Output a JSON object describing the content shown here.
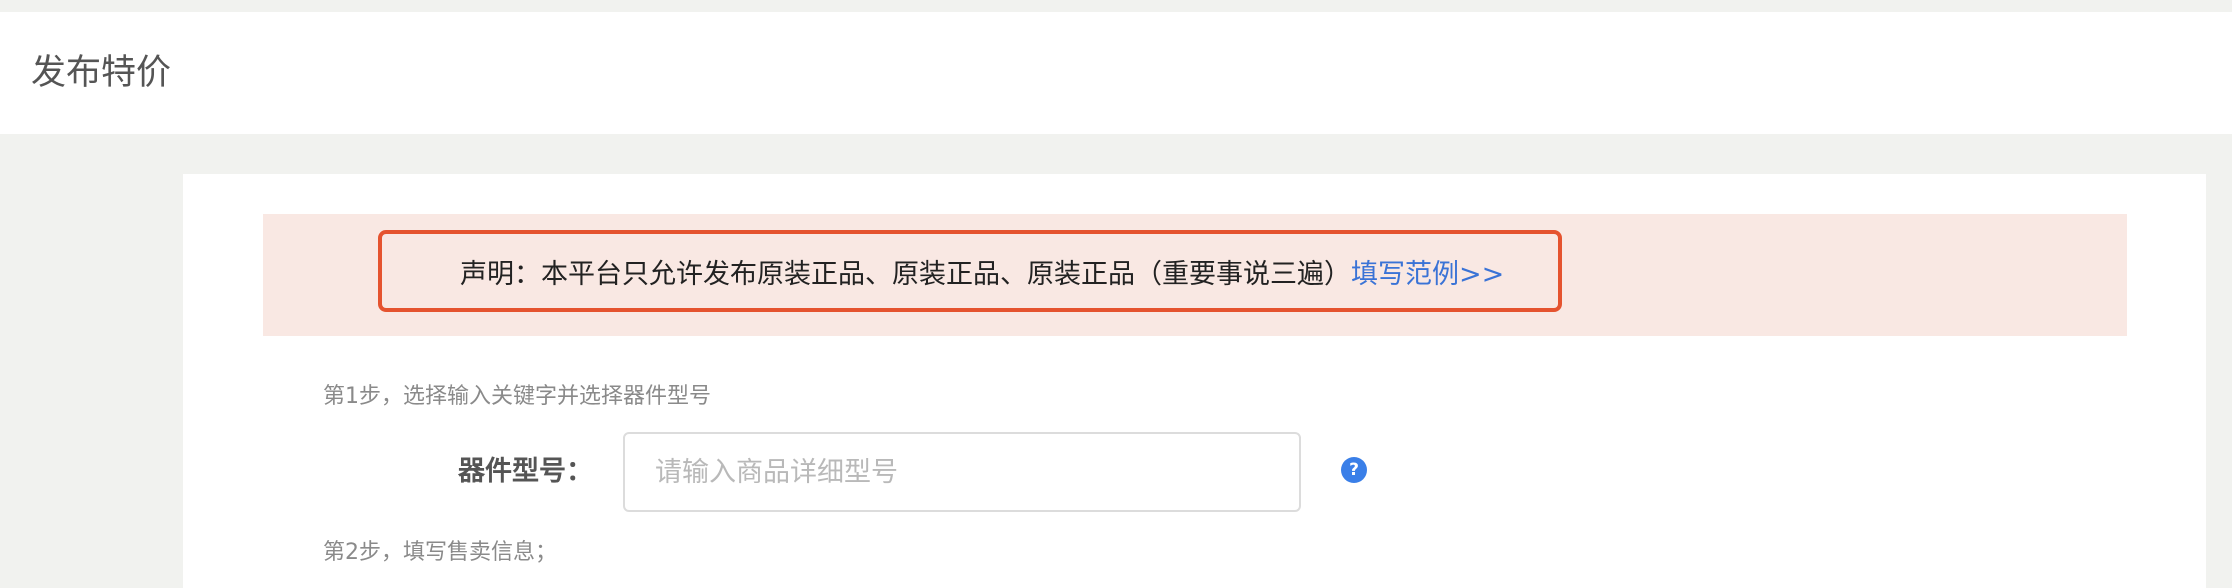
{
  "header": {
    "title": "发布特价"
  },
  "notice": {
    "text": "声明：本平台只允许发布原装正品、原装正品、原装正品（重要事说三遍）",
    "link_label": "填写范例>>"
  },
  "steps": {
    "step1": "第1步，选择输入关键字并选择器件型号",
    "step2": "第2步，填写售卖信息；"
  },
  "form": {
    "model_label": "器件型号：",
    "model_value": "",
    "model_placeholder": "请输入商品详细型号",
    "help_icon": "question-circle-icon"
  },
  "colors": {
    "notice_border": "#e5532f",
    "notice_background": "#f9e8e3",
    "link": "#3a73d6",
    "help_icon": "#3a7fe8"
  }
}
